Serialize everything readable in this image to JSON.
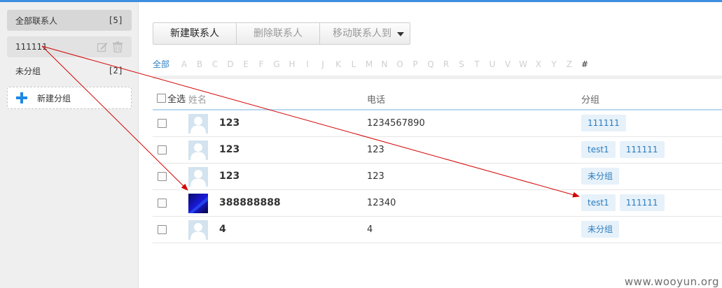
{
  "sidebar": {
    "groups": [
      {
        "label": "全部联系人",
        "count": "[5]"
      },
      {
        "label": "111111",
        "count": ""
      },
      {
        "label": "未分组",
        "count": "[2]"
      }
    ],
    "new_group_label": "新建分组"
  },
  "toolbar": {
    "new_contact": "新建联系人",
    "delete_contact": "删除联系人",
    "move_contact": "移动联系人到"
  },
  "alphabet": {
    "all": "全部",
    "letters": [
      "A",
      "B",
      "C",
      "D",
      "E",
      "F",
      "G",
      "H",
      "I",
      "J",
      "K",
      "L",
      "M",
      "N",
      "O",
      "P",
      "Q",
      "R",
      "S",
      "T",
      "U",
      "V",
      "W",
      "X",
      "Y",
      "Z"
    ],
    "hash": "#"
  },
  "table": {
    "select_all": "全选",
    "headers": {
      "name": "姓名",
      "phone": "电话",
      "group": "分组"
    },
    "rows": [
      {
        "name": "123",
        "phone": "1234567890",
        "groups": [
          "111111"
        ],
        "avatar": "default"
      },
      {
        "name": "123",
        "phone": "123",
        "groups": [
          "test1",
          "111111"
        ],
        "avatar": "default"
      },
      {
        "name": "123",
        "phone": "123",
        "groups": [
          "未分组"
        ],
        "avatar": "default"
      },
      {
        "name": "388888888",
        "phone": "12340",
        "groups": [
          "test1",
          "111111"
        ],
        "avatar": "blue-photo"
      },
      {
        "name": "4",
        "phone": "4",
        "groups": [
          "未分组"
        ],
        "avatar": "default"
      }
    ]
  },
  "watermark": "www.wooyun.org",
  "colors": {
    "accent": "#3d8ee0",
    "tag_bg": "#e6f1fa",
    "tag_text": "#2c7bbd",
    "arrow": "#d40000"
  }
}
